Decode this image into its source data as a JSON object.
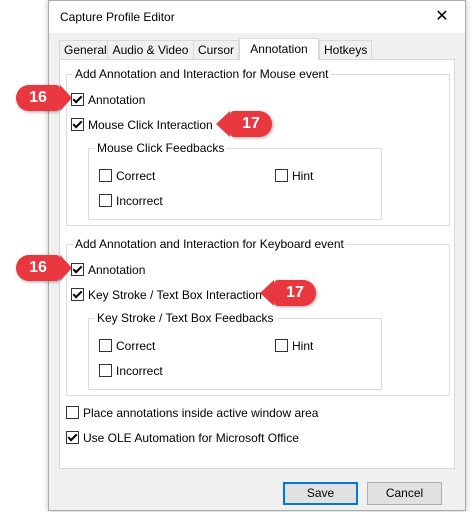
{
  "window": {
    "title": "Capture Profile Editor",
    "close_glyph": "✕"
  },
  "tabs": [
    {
      "label": "General"
    },
    {
      "label": "Audio & Video"
    },
    {
      "label": "Cursor"
    },
    {
      "label": "Annotation",
      "active": true
    },
    {
      "label": "Hotkeys"
    }
  ],
  "mouse_group": {
    "title": "Add Annotation and Interaction for Mouse event",
    "annotation": {
      "label": "Annotation",
      "checked": true
    },
    "interaction": {
      "label": "Mouse Click Interaction",
      "checked": true
    },
    "feedbacks": {
      "title": "Mouse Click Feedbacks",
      "correct": {
        "label": "Correct",
        "checked": false
      },
      "hint": {
        "label": "Hint",
        "checked": false
      },
      "incorrect": {
        "label": "Incorrect",
        "checked": false
      }
    }
  },
  "keyboard_group": {
    "title": "Add Annotation and Interaction for Keyboard event",
    "annotation": {
      "label": "Annotation",
      "checked": true
    },
    "interaction": {
      "label": "Key Stroke / Text Box Interaction",
      "checked": true
    },
    "feedbacks": {
      "title": "Key Stroke / Text Box Feedbacks",
      "correct": {
        "label": "Correct",
        "checked": false
      },
      "hint": {
        "label": "Hint",
        "checked": false
      },
      "incorrect": {
        "label": "Incorrect",
        "checked": false
      }
    }
  },
  "options": {
    "place_inside": {
      "label": "Place annotations inside active window area",
      "checked": false
    },
    "ole_automation": {
      "label": "Use OLE Automation for Microsoft Office",
      "checked": true
    }
  },
  "buttons": {
    "save": "Save",
    "cancel": "Cancel"
  },
  "callouts": {
    "c16": "16",
    "c17": "17",
    "color": "#e8373e"
  }
}
